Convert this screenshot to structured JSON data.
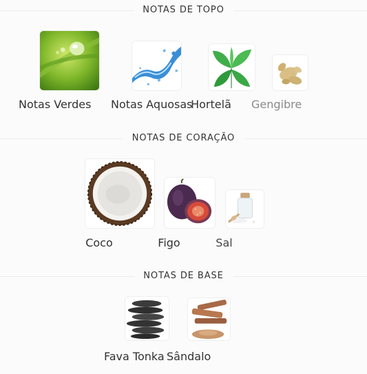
{
  "sections": {
    "top": {
      "title": "NOTAS DE TOPO",
      "notes": [
        {
          "name": "Notas Verdes",
          "icon": "green-leaf-icon"
        },
        {
          "name": "Notas Aquosas",
          "icon": "water-splash-icon"
        },
        {
          "name": "Hortelã",
          "icon": "mint-leaves-icon"
        },
        {
          "name": "Gengibre",
          "icon": "ginger-root-icon"
        }
      ]
    },
    "heart": {
      "title": "NOTAS DE CORAÇÃO",
      "notes": [
        {
          "name": "Coco",
          "icon": "coconut-icon"
        },
        {
          "name": "Figo",
          "icon": "fig-icon"
        },
        {
          "name": "Sal",
          "icon": "salt-icon"
        }
      ]
    },
    "base": {
      "title": "NOTAS DE BASE",
      "notes": [
        {
          "name": "Fava Tonka",
          "icon": "tonka-bean-icon"
        },
        {
          "name": "Sândalo",
          "icon": "sandalwood-icon"
        }
      ]
    }
  }
}
